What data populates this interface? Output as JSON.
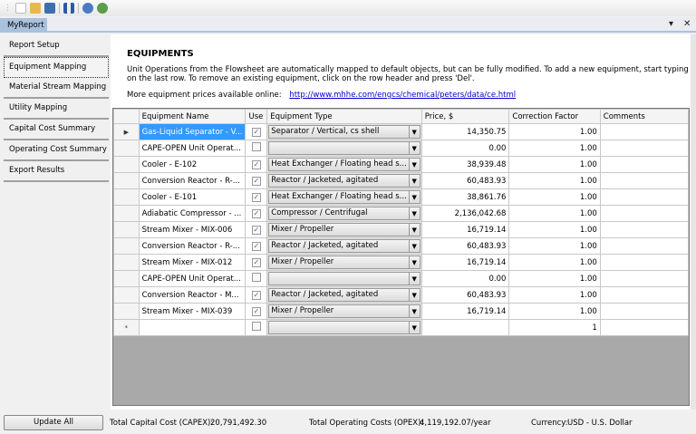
{
  "toolbar": {
    "icons": [
      "new-file-icon",
      "open-folder-icon",
      "save-icon",
      "pause-icon",
      "help-icon",
      "globe-icon"
    ]
  },
  "tab": {
    "label": "MyReport",
    "pin": "▾",
    "close": "✕"
  },
  "sidebar": {
    "items": [
      {
        "label": "Report Setup"
      },
      {
        "label": "Equipment Mapping"
      },
      {
        "label": "Material Stream Mapping"
      },
      {
        "label": "Utility Mapping"
      },
      {
        "label": "Capital Cost Summary"
      },
      {
        "label": "Operating Cost Summary"
      },
      {
        "label": "Export Results"
      }
    ]
  },
  "main": {
    "title": "EQUIPMENTS",
    "description": "Unit Operations from the Flowsheet are automatically mapped to default objects, but can be fully modified. To add a new equipment, start typing on the last row. To remove an existing equipment, click on the row header and press 'Del'.",
    "more_label": "More equipment prices available online:",
    "more_link": "http://www.mhhe.com/engcs/chemical/peters/data/ce.html",
    "columns": [
      "Equipment Name",
      "Use",
      "Equipment Type",
      "Price, $",
      "Correction Factor",
      "Comments"
    ],
    "rows": [
      {
        "name": "Gas-Liquid Separator - V...",
        "use": true,
        "type": "Separator / Vertical, cs shell",
        "price": "14,350.75",
        "cf": "1.00",
        "comments": ""
      },
      {
        "name": "CAPE-OPEN Unit Operat...",
        "use": false,
        "type": "",
        "price": "0.00",
        "cf": "1.00",
        "comments": ""
      },
      {
        "name": "Cooler - E-102",
        "use": true,
        "type": "Heat Exchanger / Floating head s...",
        "price": "38,939.48",
        "cf": "1.00",
        "comments": ""
      },
      {
        "name": "Conversion Reactor - R-...",
        "use": true,
        "type": "Reactor / Jacketed, agitated",
        "price": "60,483.93",
        "cf": "1.00",
        "comments": ""
      },
      {
        "name": "Cooler - E-101",
        "use": true,
        "type": "Heat Exchanger / Floating head s...",
        "price": "38,861.76",
        "cf": "1.00",
        "comments": ""
      },
      {
        "name": "Adiabatic Compressor - ...",
        "use": true,
        "type": "Compressor / Centrifugal",
        "price": "2,136,042.68",
        "cf": "1.00",
        "comments": ""
      },
      {
        "name": "Stream Mixer - MIX-006",
        "use": true,
        "type": "Mixer / Propeller",
        "price": "16,719.14",
        "cf": "1.00",
        "comments": ""
      },
      {
        "name": "Conversion Reactor - R-...",
        "use": true,
        "type": "Reactor / Jacketed, agitated",
        "price": "60,483.93",
        "cf": "1.00",
        "comments": ""
      },
      {
        "name": "Stream Mixer - MIX-012",
        "use": true,
        "type": "Mixer / Propeller",
        "price": "16,719.14",
        "cf": "1.00",
        "comments": ""
      },
      {
        "name": "CAPE-OPEN Unit Operat...",
        "use": false,
        "type": "",
        "price": "0.00",
        "cf": "1.00",
        "comments": ""
      },
      {
        "name": "Conversion Reactor - M...",
        "use": true,
        "type": "Reactor / Jacketed, agitated",
        "price": "60,483.93",
        "cf": "1.00",
        "comments": ""
      },
      {
        "name": "Stream Mixer - MIX-039",
        "use": true,
        "type": "Mixer / Propeller",
        "price": "16,719.14",
        "cf": "1.00",
        "comments": ""
      }
    ],
    "new_row": {
      "marker": "*",
      "cf": "1"
    },
    "current_row_marker": "▶"
  },
  "footer": {
    "update_label": "Update All",
    "capex_label": "Total Capital Cost (CAPEX):",
    "capex": "20,791,492.30",
    "opex_label": "Total Operating Costs (OPEX):",
    "opex": "4,119,192.07/year",
    "currency_label": "Currency:",
    "currency": "USD - U.S. Dollar"
  }
}
